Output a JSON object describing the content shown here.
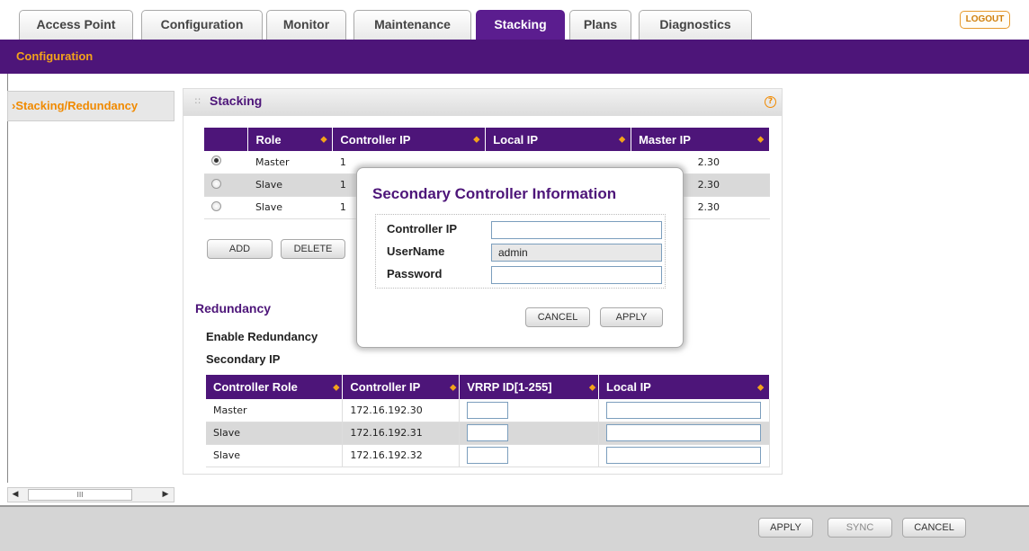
{
  "tabs": [
    {
      "label": "Access Point",
      "active": false
    },
    {
      "label": "Configuration",
      "active": false
    },
    {
      "label": "Monitor",
      "active": false
    },
    {
      "label": "Maintenance",
      "active": false
    },
    {
      "label": "Stacking",
      "active": true
    },
    {
      "label": "Plans",
      "active": false
    },
    {
      "label": "Diagnostics",
      "active": false
    }
  ],
  "logout_label": "LOGOUT",
  "subbar_label": "Configuration",
  "sidebar": {
    "item_label": "›Stacking/Redundancy",
    "scroll_thumb": "III"
  },
  "stacking": {
    "title": "Stacking",
    "help_icon": "?",
    "columns": [
      "Role",
      "Controller IP",
      "Local IP",
      "Master IP"
    ],
    "rows": [
      {
        "selected": true,
        "role": "Master",
        "controller_ip": "1",
        "local_ip": "",
        "master_ip": "2.30"
      },
      {
        "selected": false,
        "role": "Slave",
        "controller_ip": "1",
        "local_ip": "",
        "master_ip": "2.30"
      },
      {
        "selected": false,
        "role": "Slave",
        "controller_ip": "1",
        "local_ip": "",
        "master_ip": "2.30"
      }
    ],
    "add_label": "ADD",
    "delete_label": "DELETE"
  },
  "redundancy": {
    "title": "Redundancy",
    "enable_label": "Enable Redundancy",
    "secondary_ip_label": "Secondary IP",
    "columns": [
      "Controller Role",
      "Controller IP",
      "VRRP ID[1-255]",
      "Local IP"
    ],
    "rows": [
      {
        "role": "Master",
        "controller_ip": "172.16.192.30"
      },
      {
        "role": "Slave",
        "controller_ip": "172.16.192.31"
      },
      {
        "role": "Slave",
        "controller_ip": "172.16.192.32"
      }
    ]
  },
  "modal": {
    "title": "Secondary Controller Information",
    "controller_ip_label": "Controller IP",
    "controller_ip_value": "",
    "username_label": "UserName",
    "username_value": "admin",
    "password_label": "Password",
    "password_value": "",
    "cancel_label": "CANCEL",
    "apply_label": "APPLY"
  },
  "footer": {
    "apply_label": "APPLY",
    "sync_label": "SYNC",
    "cancel_label": "CANCEL"
  },
  "colors": {
    "brand_purple": "#4d1579",
    "accent_orange": "#f3a31b"
  }
}
